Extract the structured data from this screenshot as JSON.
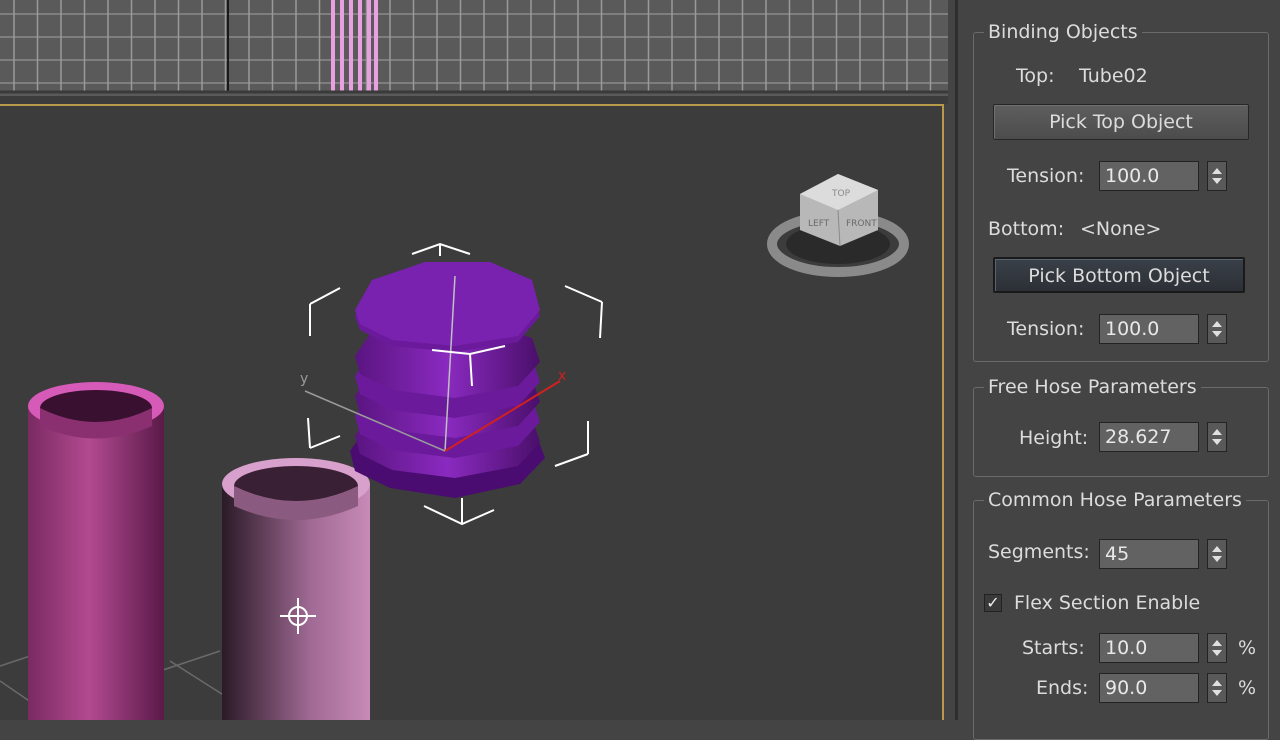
{
  "binding_objects": {
    "title": "Binding Objects",
    "top_label": "Top:",
    "top_value": "Tube02",
    "pick_top_button": "Pick Top Object",
    "tension_label": "Tension:",
    "top_tension": "100.0",
    "bottom_label": "Bottom:",
    "bottom_value": "<None>",
    "pick_bottom_button": "Pick Bottom Object",
    "bottom_tension": "100.0"
  },
  "free_hose": {
    "title": "Free Hose Parameters",
    "height_label": "Height:",
    "height_value": "28.627"
  },
  "common_hose": {
    "title": "Common Hose Parameters",
    "segments_label": "Segments:",
    "segments_value": "45",
    "flex_label": "Flex Section Enable",
    "flex_checked": true,
    "starts_label": "Starts:",
    "starts_value": "10.0",
    "ends_label": "Ends:",
    "ends_value": "90.0",
    "percent": "%"
  },
  "viewport": {
    "gizmo_axis_x": "x",
    "gizmo_axis_y": "y",
    "viewcube_faces": [
      "TOP",
      "LEFT",
      "FRONT"
    ]
  },
  "colors": {
    "hose": "#7a1fa8",
    "tube": "#b0408e",
    "selection": "#ffffff"
  }
}
